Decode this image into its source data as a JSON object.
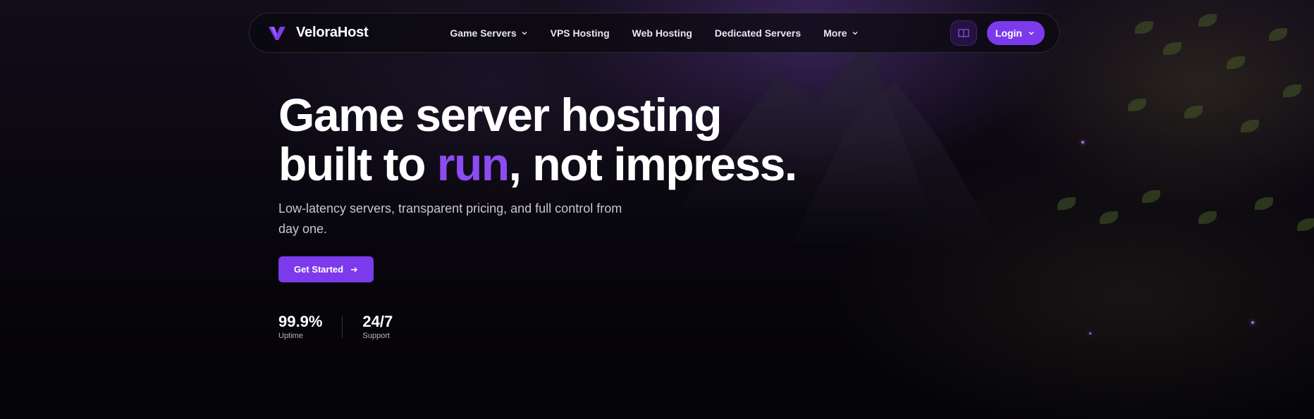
{
  "brand": {
    "name": "VeloraHost",
    "logo_icon": "velora-v-logo-icon",
    "accent": "#7c3aed"
  },
  "nav": {
    "items": [
      {
        "label": "Game Servers",
        "has_dropdown": true
      },
      {
        "label": "VPS Hosting",
        "has_dropdown": false
      },
      {
        "label": "Web Hosting",
        "has_dropdown": false
      },
      {
        "label": "Dedicated Servers",
        "has_dropdown": false
      },
      {
        "label": "More",
        "has_dropdown": true
      }
    ],
    "docs_icon": "book-icon",
    "login_label": "Login"
  },
  "hero": {
    "title_line1": "Game server hosting",
    "title_line2_pre": "built to ",
    "title_line2_accent": "run",
    "title_line2_post": ", not impress.",
    "subtitle": "Low-latency servers, transparent pricing, and full control from day one.",
    "cta_label": "Get Started",
    "cta_icon": "arrow-right-icon"
  },
  "stats": [
    {
      "value": "99.9%",
      "label": "Uptime"
    },
    {
      "value": "24/7",
      "label": "Support"
    }
  ]
}
